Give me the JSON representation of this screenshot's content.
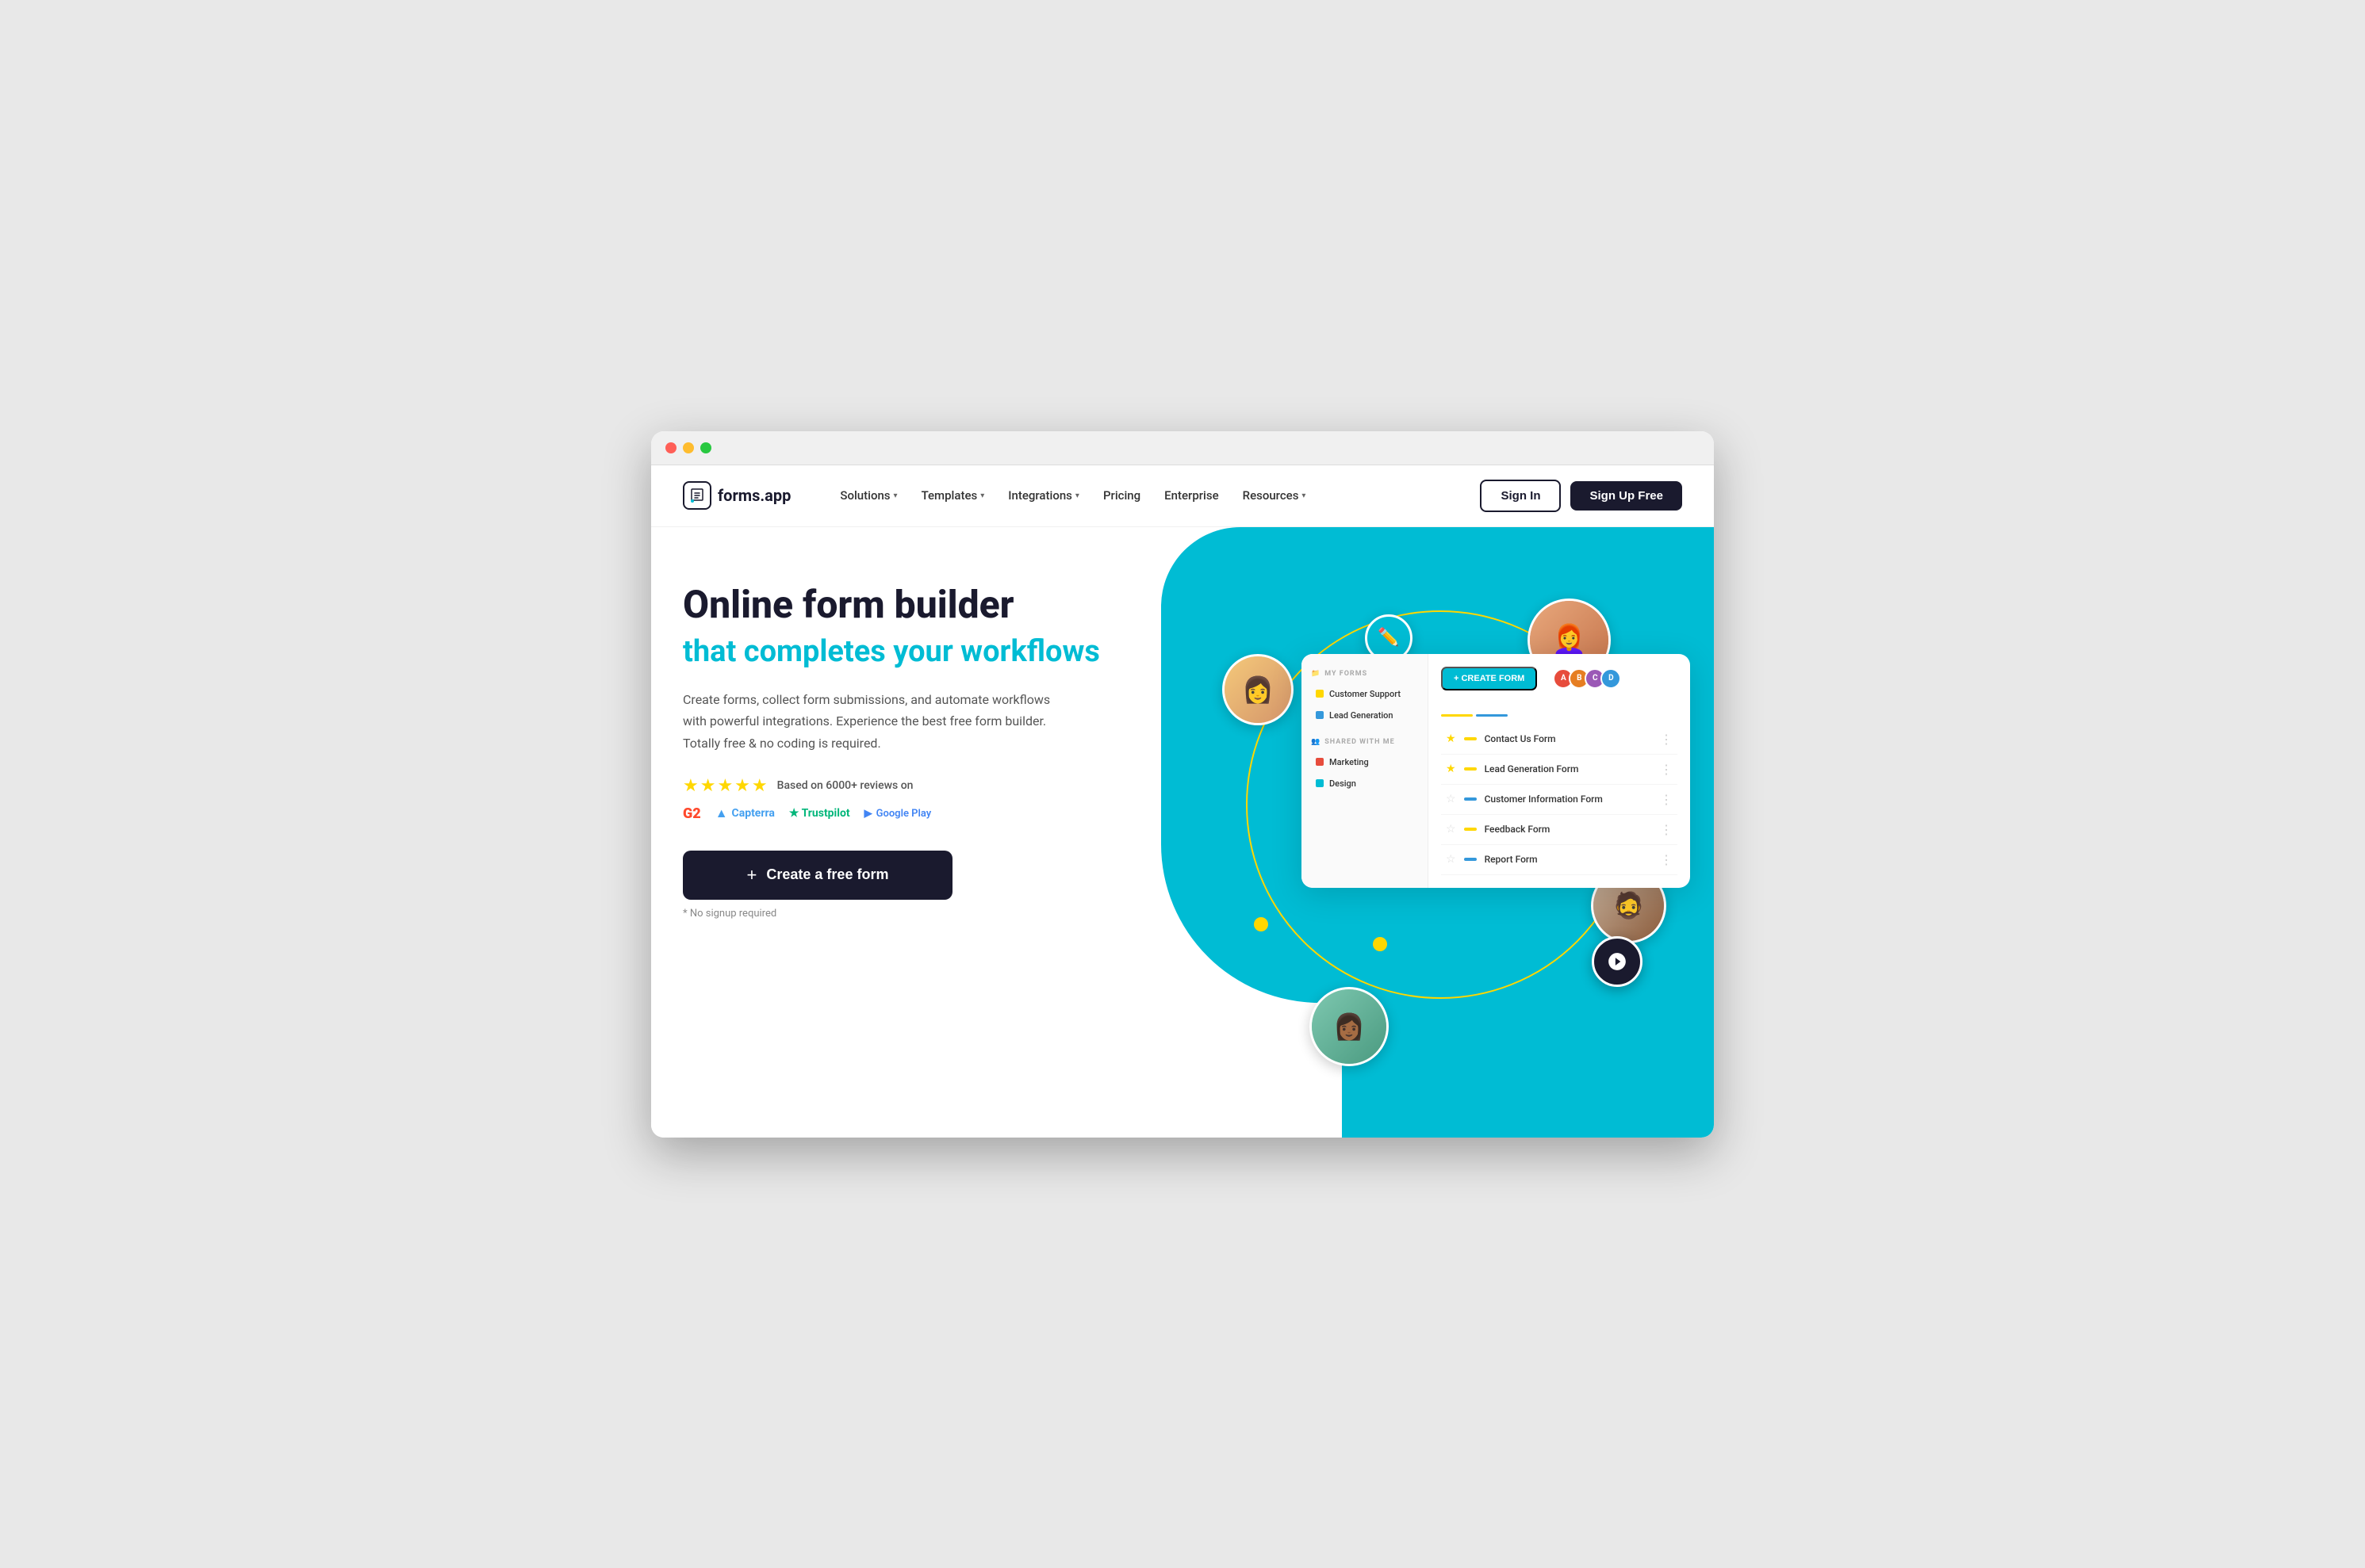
{
  "browser": {
    "dots": [
      "red",
      "yellow",
      "green"
    ]
  },
  "navbar": {
    "logo_text": "forms.app",
    "nav_items": [
      {
        "label": "Solutions",
        "has_dropdown": true
      },
      {
        "label": "Templates",
        "has_dropdown": true
      },
      {
        "label": "Integrations",
        "has_dropdown": true
      },
      {
        "label": "Pricing",
        "has_dropdown": false
      },
      {
        "label": "Enterprise",
        "has_dropdown": false
      },
      {
        "label": "Resources",
        "has_dropdown": true
      }
    ],
    "signin_label": "Sign In",
    "signup_label": "Sign Up Free"
  },
  "hero": {
    "title_line1": "Online form builder",
    "title_line2": "that completes your workflows",
    "description": "Create forms, collect form submissions, and automate workflows with powerful integrations. Experience the best free form builder. Totally free & no coding is required.",
    "reviews_text": "Based on 6000+ reviews on",
    "stars": "★★★★★",
    "logos": [
      {
        "name": "G2",
        "icon": "G2"
      },
      {
        "name": "Capterra",
        "icon": "▲ Capterra"
      },
      {
        "name": "Trustpilot",
        "icon": "★ Trustpilot"
      },
      {
        "name": "Google Play",
        "icon": "▶ Google Play"
      }
    ],
    "cta_label": "Create a free form",
    "cta_plus": "+",
    "no_signup": "* No signup required"
  },
  "form_preview": {
    "my_forms_label": "MY FORMS",
    "shared_label": "SHARED WITH ME",
    "sidebar_items": [
      {
        "label": "Customer Support",
        "color": "#FFD700"
      },
      {
        "label": "Lead Generation",
        "color": "#00bcd4"
      }
    ],
    "shared_items": [
      {
        "label": "Marketing",
        "color": "#e74c3c"
      },
      {
        "label": "Design",
        "color": "#00bcd4"
      }
    ],
    "create_form_btn": "+ CREATE FORM",
    "forms": [
      {
        "name": "Contact Us Form",
        "starred": true,
        "bar_color": "#FFD700"
      },
      {
        "name": "Lead Generation Form",
        "starred": true,
        "bar_color": "#FFD700"
      },
      {
        "name": "Customer Information Form",
        "starred": false,
        "bar_color": "#3498db"
      },
      {
        "name": "Feedback Form",
        "starred": false,
        "bar_color": "#FFD700"
      },
      {
        "name": "Report Form",
        "starred": false,
        "bar_color": "#3498db"
      }
    ]
  }
}
